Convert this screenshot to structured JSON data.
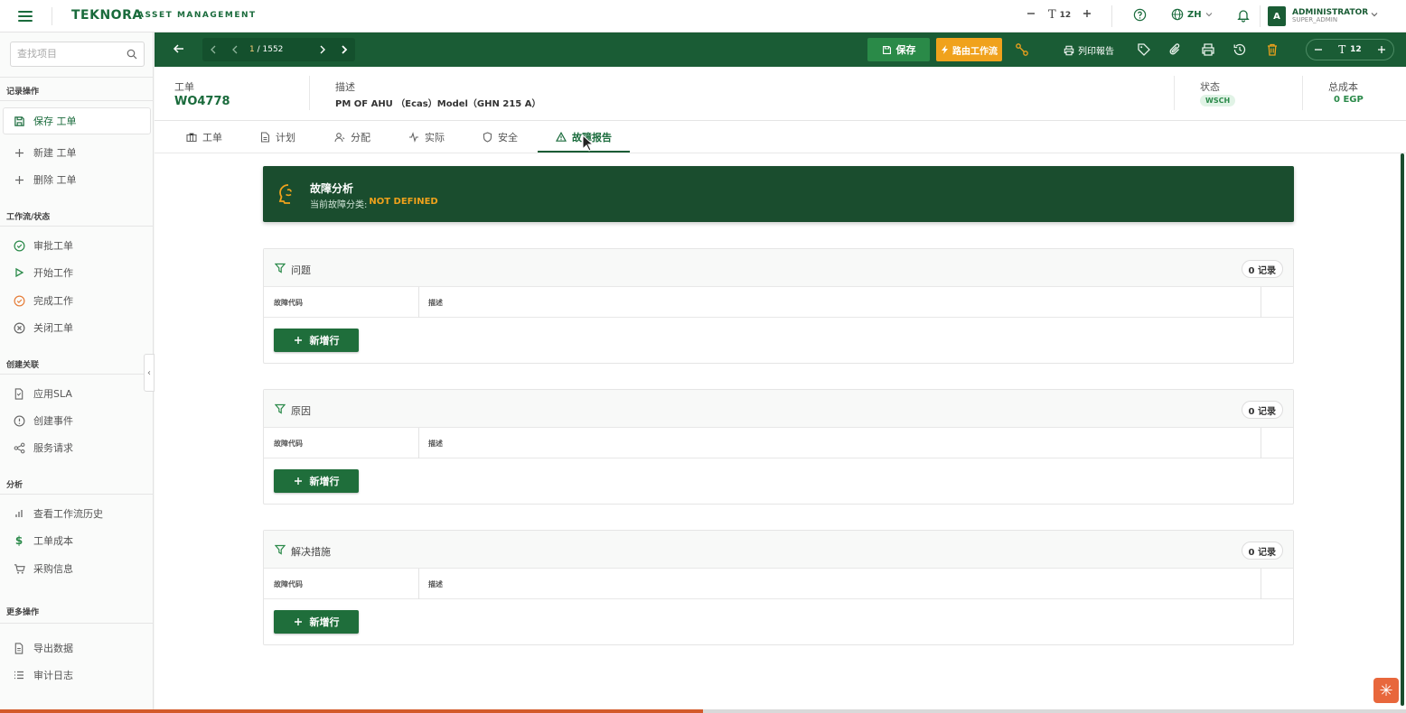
{
  "topbar": {
    "brand": "TEKNORA",
    "brand_sub": "ASSET MANAGEMENT",
    "font_size": "12",
    "language": "ZH",
    "user_name": "ADMINISTRATOR",
    "user_role": "SUPER_ADMIN",
    "avatar_letter": "A"
  },
  "sidebar": {
    "search_placeholder": "查找项目",
    "sections": {
      "record": "记录操作",
      "workflow": "工作流/状态",
      "relations": "创建关联",
      "analysis": "分析",
      "more": "更多操作"
    },
    "items": {
      "save": "保存 工单",
      "new": "新建 工单",
      "delete": "删除 工单",
      "approve": "审批工单",
      "start": "开始工作",
      "complete": "完成工作",
      "close": "关闭工单",
      "sla": "应用SLA",
      "event": "创建事件",
      "service": "服务请求",
      "history": "查看工作流历史",
      "cost": "工单成本",
      "purchase": "采购信息",
      "export": "导出数据",
      "audit": "审计日志"
    }
  },
  "toolbar": {
    "pager_current": "1",
    "pager_total": "/ 1552",
    "save_label": "保存",
    "route_label": "路由工作流",
    "print_label": "列印報告",
    "font_size": "12"
  },
  "record": {
    "wo_label": "工单",
    "wo_value": "WO4778",
    "desc_label": "描述",
    "desc_value": "PM OF AHU （Ecas）Model（GHN 215 A）",
    "status_label": "状态",
    "status_value": "WSCH",
    "cost_label": "总成本",
    "cost_value": "0 EGP"
  },
  "tabs": [
    "工单",
    "计划",
    "分配",
    "实际",
    "安全",
    "故障报告"
  ],
  "banner": {
    "title": "故障分析",
    "sub_label": "当前故障分类:",
    "sub_value": "NOT DEFINED"
  },
  "panels": [
    {
      "title": "问题",
      "count": "0 记录",
      "col1": "故障代码",
      "col2": "描述",
      "add_label": "新增行"
    },
    {
      "title": "原因",
      "count": "0 记录",
      "col1": "故障代码",
      "col2": "描述",
      "add_label": "新增行"
    },
    {
      "title": "解决措施",
      "count": "0 记录",
      "col1": "故障代码",
      "col2": "描述",
      "add_label": "新增行"
    }
  ],
  "page_progress": 0.5,
  "colors": {
    "brand_green": "#1a5c35",
    "accent_orange": "#f0a21c",
    "status_green": "#2b8a4a"
  }
}
